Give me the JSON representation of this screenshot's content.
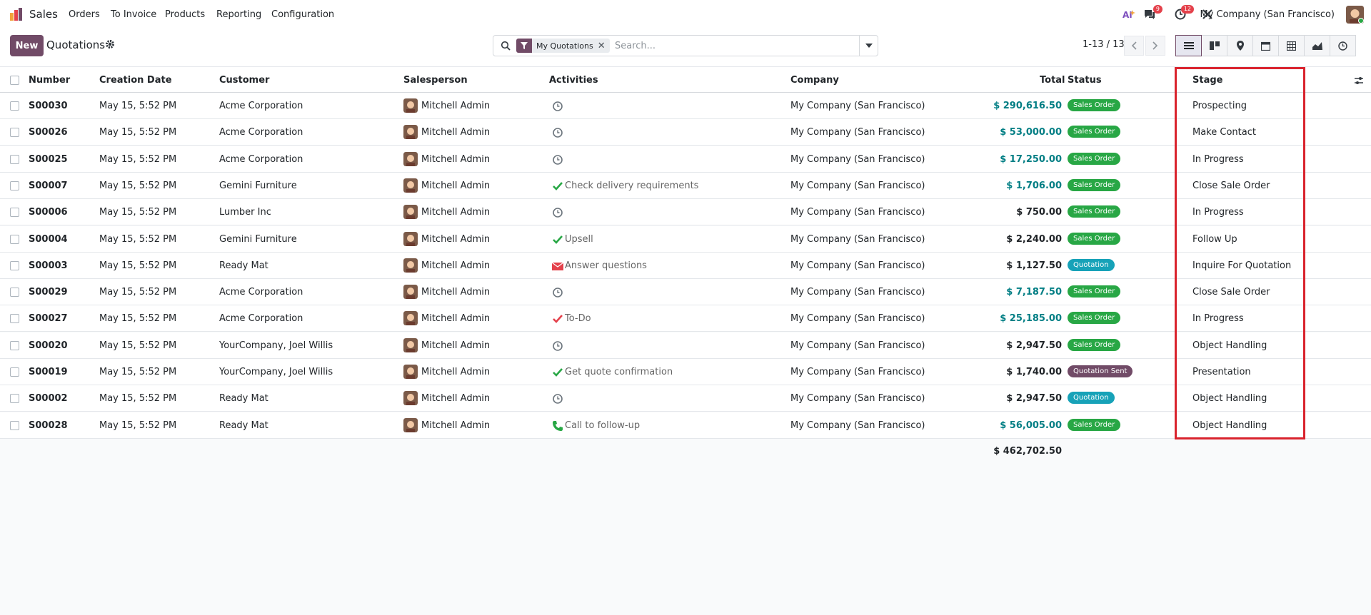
{
  "navbar": {
    "app_name": "Sales",
    "menu": [
      "Orders",
      "To Invoice",
      "Products",
      "Reporting",
      "Configuration"
    ],
    "chat_badge": "9",
    "activity_badge": "12",
    "company": "My Company (San Francisco)",
    "brand_color": "#714b67"
  },
  "control": {
    "new_label": "New",
    "title": "Quotations",
    "facet_label": "My Quotations",
    "search_placeholder": "Search...",
    "pager": "1-13 / 13"
  },
  "table": {
    "headers": {
      "number": "Number",
      "creation_date": "Creation Date",
      "customer": "Customer",
      "salesperson": "Salesperson",
      "activities": "Activities",
      "company": "Company",
      "total": "Total",
      "status": "Status",
      "stage": "Stage"
    },
    "rows": [
      {
        "number": "S00030",
        "date": "May 15, 5:52 PM",
        "customer": "Acme Corporation",
        "salesperson": "Mitchell Admin",
        "activity_icon": "clock-icon",
        "activity": "",
        "company": "My Company (San Francisco)",
        "total": "$ 290,616.50",
        "total_color": "#017e84",
        "status": "Sales Order",
        "status_color": "#28a745",
        "stage": "Prospecting"
      },
      {
        "number": "S00026",
        "date": "May 15, 5:52 PM",
        "customer": "Acme Corporation",
        "salesperson": "Mitchell Admin",
        "activity_icon": "clock-icon",
        "activity": "",
        "company": "My Company (San Francisco)",
        "total": "$ 53,000.00",
        "total_color": "#017e84",
        "status": "Sales Order",
        "status_color": "#28a745",
        "stage": "Make Contact"
      },
      {
        "number": "S00025",
        "date": "May 15, 5:52 PM",
        "customer": "Acme Corporation",
        "salesperson": "Mitchell Admin",
        "activity_icon": "clock-icon",
        "activity": "",
        "company": "My Company (San Francisco)",
        "total": "$ 17,250.00",
        "total_color": "#017e84",
        "status": "Sales Order",
        "status_color": "#28a745",
        "stage": "In Progress"
      },
      {
        "number": "S00007",
        "date": "May 15, 5:52 PM",
        "customer": "Gemini Furniture",
        "salesperson": "Mitchell Admin",
        "activity_icon": "check-icon",
        "activity": "Check delivery requirements",
        "company": "My Company (San Francisco)",
        "total": "$ 1,706.00",
        "total_color": "#017e84",
        "status": "Sales Order",
        "status_color": "#28a745",
        "stage": "Close Sale Order"
      },
      {
        "number": "S00006",
        "date": "May 15, 5:52 PM",
        "customer": "Lumber Inc",
        "salesperson": "Mitchell Admin",
        "activity_icon": "clock-icon",
        "activity": "",
        "company": "My Company (San Francisco)",
        "total": "$ 750.00",
        "total_color": "#212529",
        "status": "Sales Order",
        "status_color": "#28a745",
        "stage": "In Progress"
      },
      {
        "number": "S00004",
        "date": "May 15, 5:52 PM",
        "customer": "Gemini Furniture",
        "salesperson": "Mitchell Admin",
        "activity_icon": "check-icon",
        "activity": "Upsell",
        "company": "My Company (San Francisco)",
        "total": "$ 2,240.00",
        "total_color": "#212529",
        "status": "Sales Order",
        "status_color": "#28a745",
        "stage": "Follow Up"
      },
      {
        "number": "S00003",
        "date": "May 15, 5:52 PM",
        "customer": "Ready Mat",
        "salesperson": "Mitchell Admin",
        "activity_icon": "envelope-icon",
        "activity": "Answer questions",
        "company": "My Company (San Francisco)",
        "total": "$ 1,127.50",
        "total_color": "#212529",
        "status": "Quotation",
        "status_color": "#17a2b8",
        "stage": "Inquire For Quotation"
      },
      {
        "number": "S00029",
        "date": "May 15, 5:52 PM",
        "customer": "Acme Corporation",
        "salesperson": "Mitchell Admin",
        "activity_icon": "clock-icon",
        "activity": "",
        "company": "My Company (San Francisco)",
        "total": "$ 7,187.50",
        "total_color": "#017e84",
        "status": "Sales Order",
        "status_color": "#28a745",
        "stage": "Close Sale Order"
      },
      {
        "number": "S00027",
        "date": "May 15, 5:52 PM",
        "customer": "Acme Corporation",
        "salesperson": "Mitchell Admin",
        "activity_icon": "todo-check-icon",
        "activity": "To-Do",
        "company": "My Company (San Francisco)",
        "total": "$ 25,185.00",
        "total_color": "#017e84",
        "status": "Sales Order",
        "status_color": "#28a745",
        "stage": "In Progress"
      },
      {
        "number": "S00020",
        "date": "May 15, 5:52 PM",
        "customer": "YourCompany, Joel Willis",
        "salesperson": "Mitchell Admin",
        "activity_icon": "clock-icon",
        "activity": "",
        "company": "My Company (San Francisco)",
        "total": "$ 2,947.50",
        "total_color": "#212529",
        "status": "Sales Order",
        "status_color": "#28a745",
        "stage": "Object Handling"
      },
      {
        "number": "S00019",
        "date": "May 15, 5:52 PM",
        "customer": "YourCompany, Joel Willis",
        "salesperson": "Mitchell Admin",
        "activity_icon": "check-icon",
        "activity": "Get quote confirmation",
        "company": "My Company (San Francisco)",
        "total": "$ 1,740.00",
        "total_color": "#212529",
        "status": "Quotation Sent",
        "status_color": "#714b67",
        "stage": "Presentation"
      },
      {
        "number": "S00002",
        "date": "May 15, 5:52 PM",
        "customer": "Ready Mat",
        "salesperson": "Mitchell Admin",
        "activity_icon": "clock-icon",
        "activity": "",
        "company": "My Company (San Francisco)",
        "total": "$ 2,947.50",
        "total_color": "#212529",
        "status": "Quotation",
        "status_color": "#17a2b8",
        "stage": "Object Handling"
      },
      {
        "number": "S00028",
        "date": "May 15, 5:52 PM",
        "customer": "Ready Mat",
        "salesperson": "Mitchell Admin",
        "activity_icon": "phone-icon",
        "activity": "Call to follow-up",
        "company": "My Company (San Francisco)",
        "total": "$ 56,005.00",
        "total_color": "#017e84",
        "status": "Sales Order",
        "status_color": "#28a745",
        "stage": "Object Handling"
      }
    ],
    "grand_total": "$ 462,702.50"
  }
}
